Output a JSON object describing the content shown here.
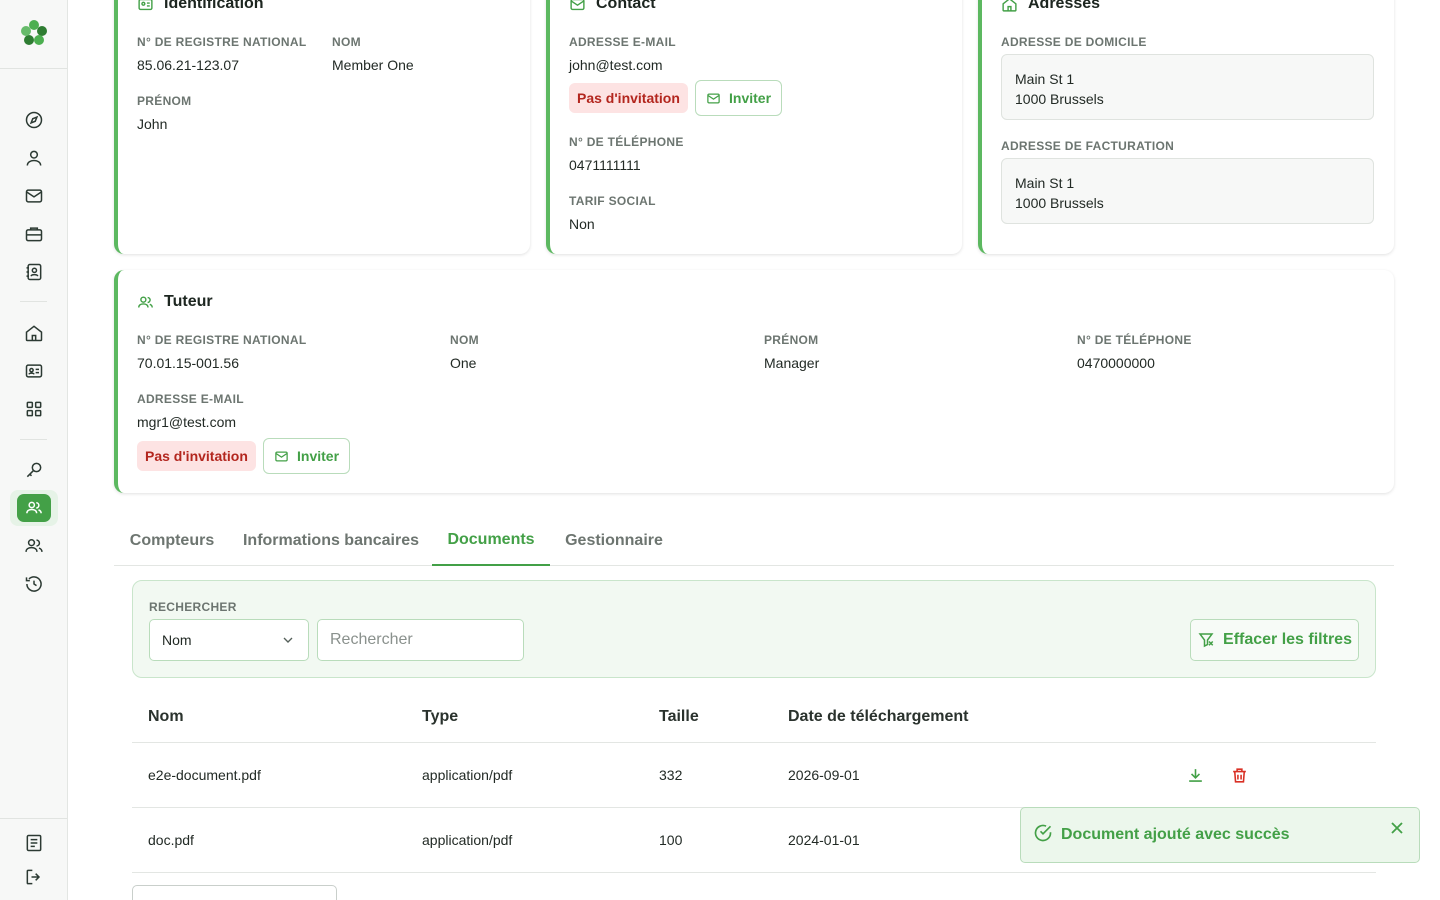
{
  "sidebar": {
    "icons": [
      "compass-icon",
      "user-icon",
      "mail-icon",
      "briefcase-icon",
      "contact-book-icon",
      "home-icon",
      "id-card-icon",
      "grid-icon",
      "key-icon",
      "members-icon",
      "group-icon",
      "history-icon",
      "document-icon",
      "logout-icon"
    ],
    "accent": "#43a047"
  },
  "identification": {
    "title": "Identification",
    "registry_label": "N° de registre national",
    "registry_value": "85.06.21-123.07",
    "lastname_label": "Nom",
    "lastname_value": "Member One",
    "firstname_label": "Prénom",
    "firstname_value": "John"
  },
  "contact": {
    "title": "Contact",
    "email_label": "Adresse e-mail",
    "email_value": "john@test.com",
    "invitation_badge": "Pas d'invitation",
    "invite_label": "Inviter",
    "phone_label": "N° de téléphone",
    "phone_value": "0471111111",
    "social_label": "Tarif social",
    "social_value": "Non"
  },
  "addresses": {
    "title": "Adresses",
    "home_label": "Adresse de domicile",
    "home_line1": "Main St 1",
    "home_line2": "1000 Brussels",
    "billing_label": "Adresse de facturation",
    "billing_line1": "Main St 1",
    "billing_line2": "1000 Brussels"
  },
  "guardian": {
    "title": "Tuteur",
    "registry_label": "N° de registre national",
    "registry_value": "70.01.15-001.56",
    "lastname_label": "Nom",
    "lastname_value": "One",
    "firstname_label": "Prénom",
    "firstname_value": "Manager",
    "phone_label": "N° de téléphone",
    "phone_value": "0470000000",
    "email_label": "Adresse e-mail",
    "email_value": "mgr1@test.com",
    "invitation_badge": "Pas d'invitation",
    "invite_label": "Inviter"
  },
  "tabs": {
    "meters": "Compteurs",
    "bank": "Informations bancaires",
    "documents": "Documents",
    "manager": "Gestionnaire",
    "active": "Documents"
  },
  "filter": {
    "search_label": "Rechercher",
    "field_selected": "Nom",
    "search_placeholder": "Rechercher",
    "search_value": "",
    "clear_label": "Effacer les filtres"
  },
  "table": {
    "headers": {
      "name": "Nom",
      "type": "Type",
      "size": "Taille",
      "date": "Date de téléchargement"
    },
    "rows": [
      {
        "name": "e2e-document.pdf",
        "type": "application/pdf",
        "size": "332",
        "date": "2026-09-01"
      },
      {
        "name": "doc.pdf",
        "type": "application/pdf",
        "size": "100",
        "date": "2024-01-01"
      }
    ]
  },
  "toast": {
    "message": "Document ajouté avec succès"
  }
}
